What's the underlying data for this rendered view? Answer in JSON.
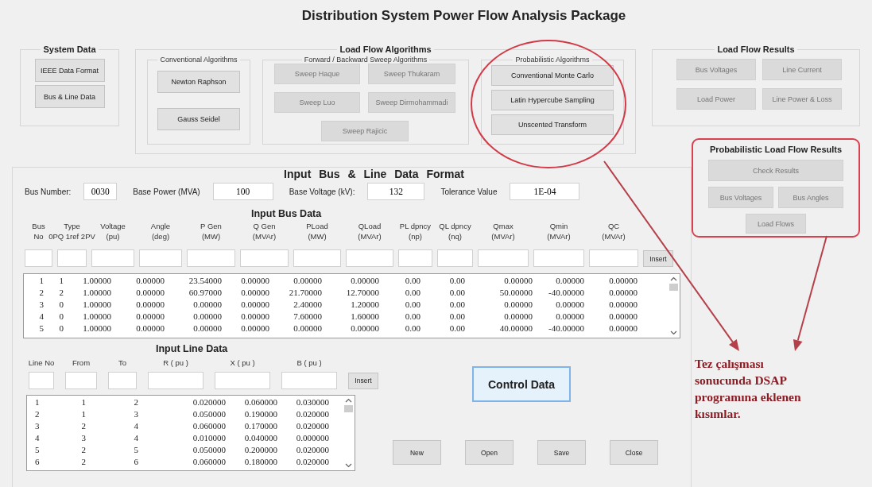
{
  "title": "Distribution System Power Flow Analysis Package",
  "system_data": {
    "title": "System Data",
    "buttons": [
      {
        "label": "IEEE Data Format",
        "disabled": false
      },
      {
        "label": "Bus & Line Data",
        "disabled": false
      }
    ]
  },
  "load_flow_algorithms": {
    "title": "Load Flow Algorithms",
    "groups": [
      {
        "title": "Conventional Algorithms",
        "kind": "column",
        "buttons": [
          {
            "label": "Newton Raphson",
            "disabled": false
          },
          {
            "label": "Gauss Seidel",
            "disabled": false
          }
        ]
      },
      {
        "title": "Forward / Backward Sweep Algorithms",
        "kind": "grid",
        "buttons": [
          {
            "label": "Sweep Haque",
            "disabled": true
          },
          {
            "label": "Sweep Thukaram",
            "disabled": true
          },
          {
            "label": "Sweep Luo",
            "disabled": true
          },
          {
            "label": "Sweep Dirmohammadi",
            "disabled": true
          },
          {
            "label": "Sweep Rajicic",
            "disabled": true
          }
        ]
      },
      {
        "title": "Probabilistic Algorithms",
        "kind": "stack",
        "buttons": [
          {
            "label": "Conventional Monte Carlo",
            "disabled": false
          },
          {
            "label": "Latin Hypercube Sampling",
            "disabled": false
          },
          {
            "label": "Unscented Transform",
            "disabled": false
          }
        ]
      }
    ]
  },
  "load_flow_results": {
    "title": "Load Flow Results",
    "buttons": [
      {
        "label": "Bus Voltages",
        "disabled": true
      },
      {
        "label": "Line Current",
        "disabled": true
      },
      {
        "label": "Load Power",
        "disabled": true
      },
      {
        "label": "Line Power & Loss",
        "disabled": true
      }
    ]
  },
  "probabilistic_results": {
    "title": "Probabilistic Load Flow Results",
    "highlighted": true,
    "buttons": [
      {
        "label": "Check Results",
        "disabled": true
      },
      {
        "label": "Bus Voltages",
        "disabled": true
      },
      {
        "label": "Bus Angles",
        "disabled": true
      },
      {
        "label": "Load Flows",
        "disabled": true
      }
    ]
  },
  "input_panel": {
    "title": "Input Bus & Line Data Format",
    "fields": [
      {
        "label": "Bus Number:",
        "value": "0030"
      },
      {
        "label": "Base Power (MVA)",
        "value": "100"
      },
      {
        "label": "Base Voltage (kV):",
        "value": "132"
      },
      {
        "label": "Tolerance Value",
        "value": "1E-04"
      }
    ],
    "bus_data": {
      "title": "Input Bus Data",
      "insert_button": "Insert",
      "columns": [
        "Bus\nNo",
        "Type\n0PQ 1ref 2PV",
        "Voltage\n(pu)",
        "Angle\n(deg)",
        "P Gen\n(MW)",
        "Q Gen\n(MVAr)",
        "PLoad\n(MW)",
        "QLoad\n(MVAr)",
        "PL dpncy\n(np)",
        "QL dpncy\n(nq)",
        "Qmax\n(MVAr)",
        "Qmin\n(MVAr)",
        "QC\n(MVAr)"
      ],
      "rows": [
        [
          "1",
          "1",
          "1.00000",
          "0.00000",
          "23.54000",
          "0.00000",
          "0.00000",
          "0.00000",
          "0.00",
          "0.00",
          "0.00000",
          "0.00000",
          "0.00000"
        ],
        [
          "2",
          "2",
          "1.00000",
          "0.00000",
          "60.97000",
          "0.00000",
          "21.70000",
          "12.70000",
          "0.00",
          "0.00",
          "50.00000",
          "-40.00000",
          "0.00000"
        ],
        [
          "3",
          "0",
          "1.00000",
          "0.00000",
          "0.00000",
          "0.00000",
          "2.40000",
          "1.20000",
          "0.00",
          "0.00",
          "0.00000",
          "0.00000",
          "0.00000"
        ],
        [
          "4",
          "0",
          "1.00000",
          "0.00000",
          "0.00000",
          "0.00000",
          "7.60000",
          "1.60000",
          "0.00",
          "0.00",
          "0.00000",
          "0.00000",
          "0.00000"
        ],
        [
          "5",
          "0",
          "1.00000",
          "0.00000",
          "0.00000",
          "0.00000",
          "0.00000",
          "0.00000",
          "0.00",
          "0.00",
          "40.00000",
          "-40.00000",
          "0.00000"
        ]
      ]
    },
    "line_data": {
      "title": "Input Line Data",
      "insert_button": "Insert",
      "columns": [
        "Line No",
        "From",
        "To",
        "R ( pu )",
        "X ( pu )",
        "B ( pu )"
      ],
      "rows": [
        [
          "1",
          "1",
          "2",
          "0.020000",
          "0.060000",
          "0.030000"
        ],
        [
          "2",
          "1",
          "3",
          "0.050000",
          "0.190000",
          "0.020000"
        ],
        [
          "3",
          "2",
          "4",
          "0.060000",
          "0.170000",
          "0.020000"
        ],
        [
          "4",
          "3",
          "4",
          "0.010000",
          "0.040000",
          "0.000000"
        ],
        [
          "5",
          "2",
          "5",
          "0.050000",
          "0.200000",
          "0.020000"
        ],
        [
          "6",
          "2",
          "6",
          "0.060000",
          "0.180000",
          "0.020000"
        ]
      ]
    },
    "control_button": {
      "label": "Control Data",
      "focused": true
    },
    "buttons": [
      {
        "label": "New"
      },
      {
        "label": "Open"
      },
      {
        "label": "Save"
      },
      {
        "label": "Close"
      }
    ]
  },
  "annotation": {
    "text": "Tez çalışması sonucunda DSAP programına eklenen kısımlar."
  }
}
